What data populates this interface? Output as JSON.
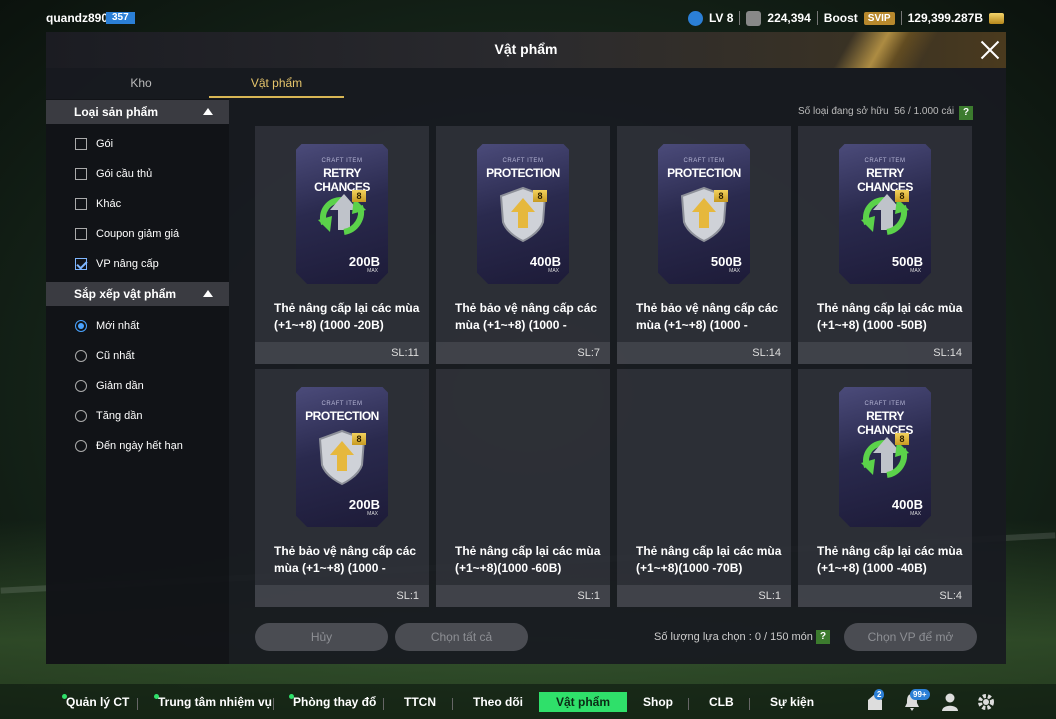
{
  "user": {
    "name": "quandz890",
    "level_badge": "357",
    "lv": "LV 8",
    "points": "224,394",
    "boost": "Boost",
    "svip": "SVIP",
    "balance": "129,399.287B"
  },
  "window": {
    "title": "Vật phẩm",
    "tabs": [
      "Kho",
      "Vật phẩm"
    ],
    "active_tab": "Vật phẩm"
  },
  "filters": {
    "product_type": {
      "title": "Loại sản phẩm",
      "options": [
        {
          "label": "Gói",
          "checked": false
        },
        {
          "label": "Gói cầu thủ",
          "checked": false
        },
        {
          "label": "Khác",
          "checked": false
        },
        {
          "label": "Coupon giảm giá",
          "checked": false
        },
        {
          "label": "VP nâng cấp",
          "checked": true
        }
      ]
    },
    "sort": {
      "title": "Sắp xếp vật phẩm",
      "options": [
        {
          "label": "Mới nhất",
          "selected": true
        },
        {
          "label": "Cũ nhất",
          "selected": false
        },
        {
          "label": "Giảm dần",
          "selected": false
        },
        {
          "label": "Tăng dần",
          "selected": false
        },
        {
          "label": "Đến ngày hết hạn",
          "selected": false
        }
      ]
    }
  },
  "inventory": {
    "count_label": "Số loại đang sở hữu",
    "count_value": "56 / 1.000 cái",
    "help": "?"
  },
  "items": [
    {
      "pack_title": "RETRY CHANCES",
      "craft": "CRAFT ITEM",
      "value": "200B",
      "max": "MAX",
      "level": "8",
      "name": "Thẻ nâng cấp lại các mùa (+1~+8) (1000 -20B)",
      "qty": "SL:11",
      "type": "retry"
    },
    {
      "pack_title": "PROTECTION",
      "craft": "CRAFT ITEM",
      "value": "400B",
      "max": "MAX",
      "level": "8",
      "name": "Thẻ bảo vệ nâng cấp các mùa (+1~+8) (1000 -",
      "qty": "SL:7",
      "type": "protect"
    },
    {
      "pack_title": "PROTECTION",
      "craft": "CRAFT ITEM",
      "value": "500B",
      "max": "MAX",
      "level": "8",
      "name": "Thẻ bảo vệ nâng cấp các mùa (+1~+8) (1000 -",
      "qty": "SL:14",
      "type": "protect"
    },
    {
      "pack_title": "RETRY CHANCES",
      "craft": "CRAFT ITEM",
      "value": "500B",
      "max": "MAX",
      "level": "8",
      "name": "Thẻ nâng cấp lại các mùa (+1~+8) (1000 -50B)",
      "qty": "SL:14",
      "type": "retry"
    },
    {
      "pack_title": "PROTECTION",
      "craft": "CRAFT ITEM",
      "value": "200B",
      "max": "MAX",
      "level": "8",
      "name": "Thẻ bảo vệ nâng cấp các mùa (+1~+8) (1000 -",
      "qty": "SL:1",
      "type": "protect"
    },
    {
      "pack_title": "",
      "craft": "",
      "value": "",
      "max": "",
      "level": "",
      "name": "Thẻ nâng cấp lại các mùa (+1~+8)(1000 -60B)",
      "qty": "SL:1",
      "type": "empty"
    },
    {
      "pack_title": "",
      "craft": "",
      "value": "",
      "max": "",
      "level": "",
      "name": "Thẻ nâng cấp lại các mùa (+1~+8)(1000 -70B)",
      "qty": "SL:1",
      "type": "empty"
    },
    {
      "pack_title": "RETRY CHANCES",
      "craft": "CRAFT ITEM",
      "value": "400B",
      "max": "MAX",
      "level": "8",
      "name": "Thẻ nâng cấp lại các mùa (+1~+8) (1000 -40B)",
      "qty": "SL:4",
      "type": "retry"
    }
  ],
  "actions": {
    "cancel": "Hủy",
    "select_all": "Chọn tất cả",
    "selection_label": "Số lượng lựa chọn : 0 / 150 món",
    "help": "?",
    "choose": "Chọn VP để mở"
  },
  "nav": {
    "items": [
      "Quản lý CT",
      "Trung tâm nhiệm vụ",
      "Phòng thay đổ",
      "TTCN",
      "Theo dõi",
      "Vật phẩm",
      "Shop",
      "CLB",
      "Sự kiện"
    ],
    "active": "Vật phẩm",
    "badge_mail": "2",
    "badge_notify": "99+"
  },
  "colors": {
    "accent_green": "#2fe06a",
    "gold": "#d8b654",
    "blue": "#2b7fd6"
  }
}
